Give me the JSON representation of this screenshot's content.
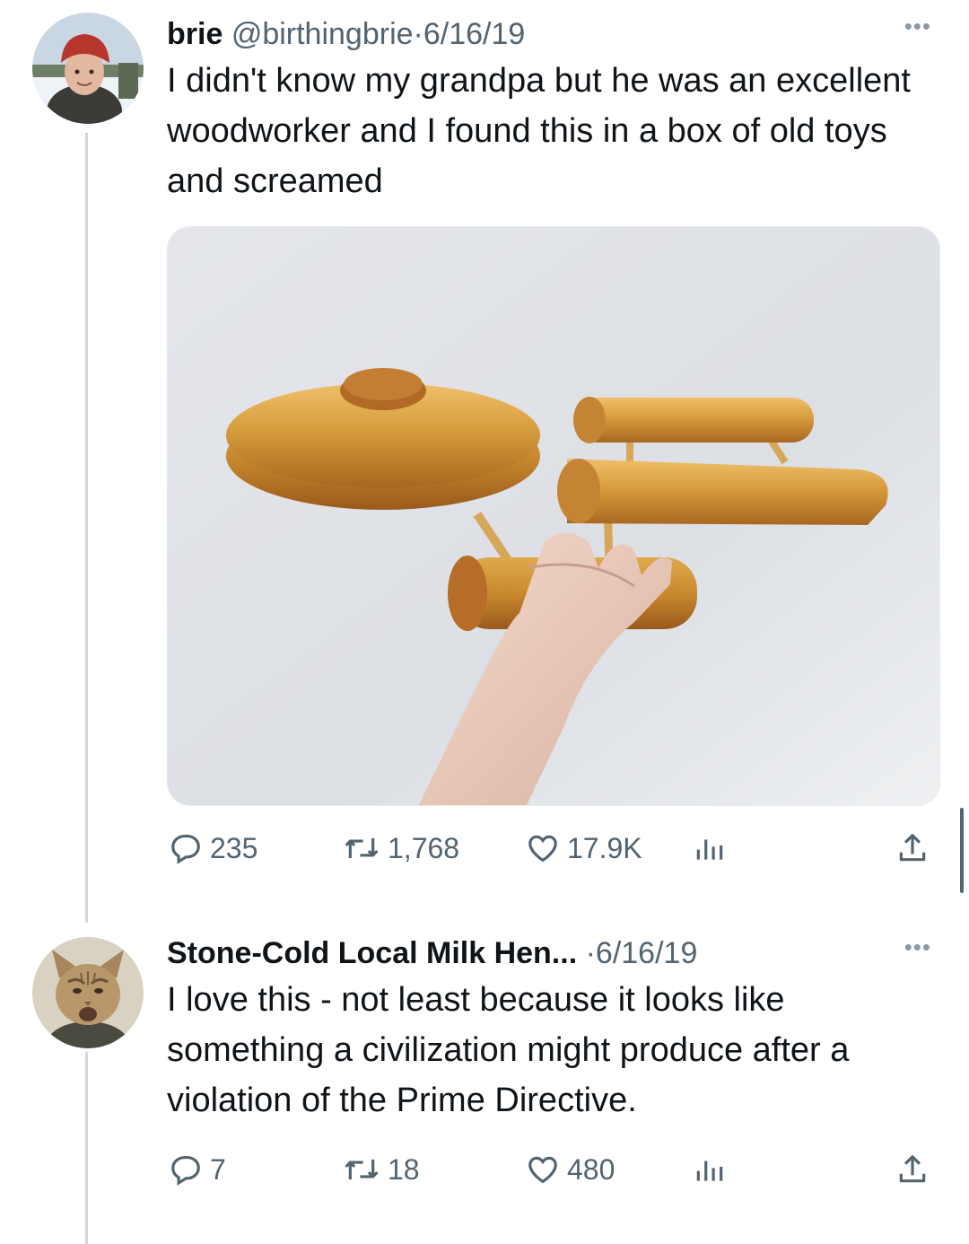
{
  "tweets": [
    {
      "display_name": "brie",
      "handle": "@birthingbrie",
      "sep": "·",
      "date": "6/16/19",
      "text": "I didn't know my grandpa but he was an excellent woodworker and I found this in a box of old toys and screamed",
      "stats": {
        "replies": "235",
        "retweets": "1,768",
        "likes": "17.9K"
      },
      "avatar_icon": "person-red-hat-avatar",
      "media_icon": "wooden-starship-toy-photo"
    },
    {
      "display_name": "Stone-Cold Local Milk Hen...",
      "sep": "·",
      "date": "6/16/19",
      "text": "I love this - not least because it looks like something a civilization might produce after a violation of the Prime Directive.",
      "stats": {
        "replies": "7",
        "retweets": "18",
        "likes": "480"
      },
      "avatar_icon": "cat-avatar"
    }
  ],
  "icons": {
    "reply": "reply-bubble-icon",
    "retweet": "retweet-arrows-icon",
    "like": "heart-icon",
    "views": "analytics-bars-icon",
    "share": "share-upload-icon",
    "more": "more-dots-icon"
  },
  "colors": {
    "text": "#0f1419",
    "secondary": "#536471",
    "thread": "#cfd9de"
  }
}
